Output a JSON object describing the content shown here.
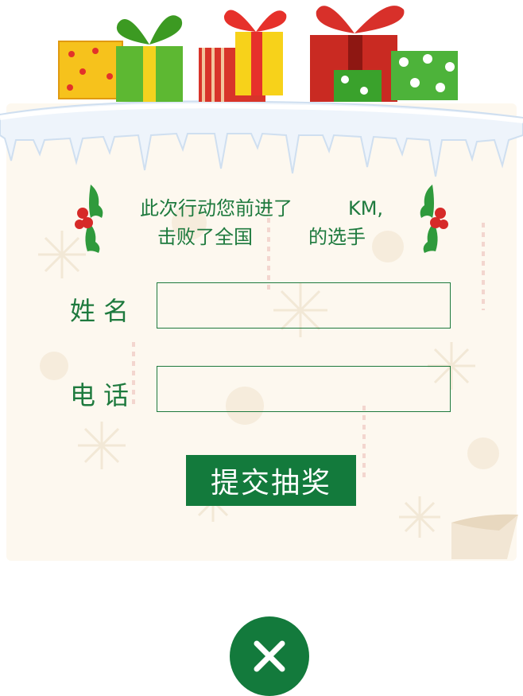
{
  "message": {
    "line1_prefix": "此次行动您前进了",
    "line1_suffix": "KM,",
    "line2_prefix": "击败了全国",
    "line2_suffix": "的选手"
  },
  "form": {
    "name_label": "姓名",
    "phone_label": "电话",
    "name_value": "",
    "phone_value": "",
    "submit_label": "提交抽奖"
  },
  "icons": {
    "close": "close-icon",
    "holly": "holly-icon",
    "gifts": "gift-boxes-icon"
  },
  "colors": {
    "accent": "#137a3c",
    "text": "#1e7a3e",
    "card": "#fdf8ef"
  }
}
